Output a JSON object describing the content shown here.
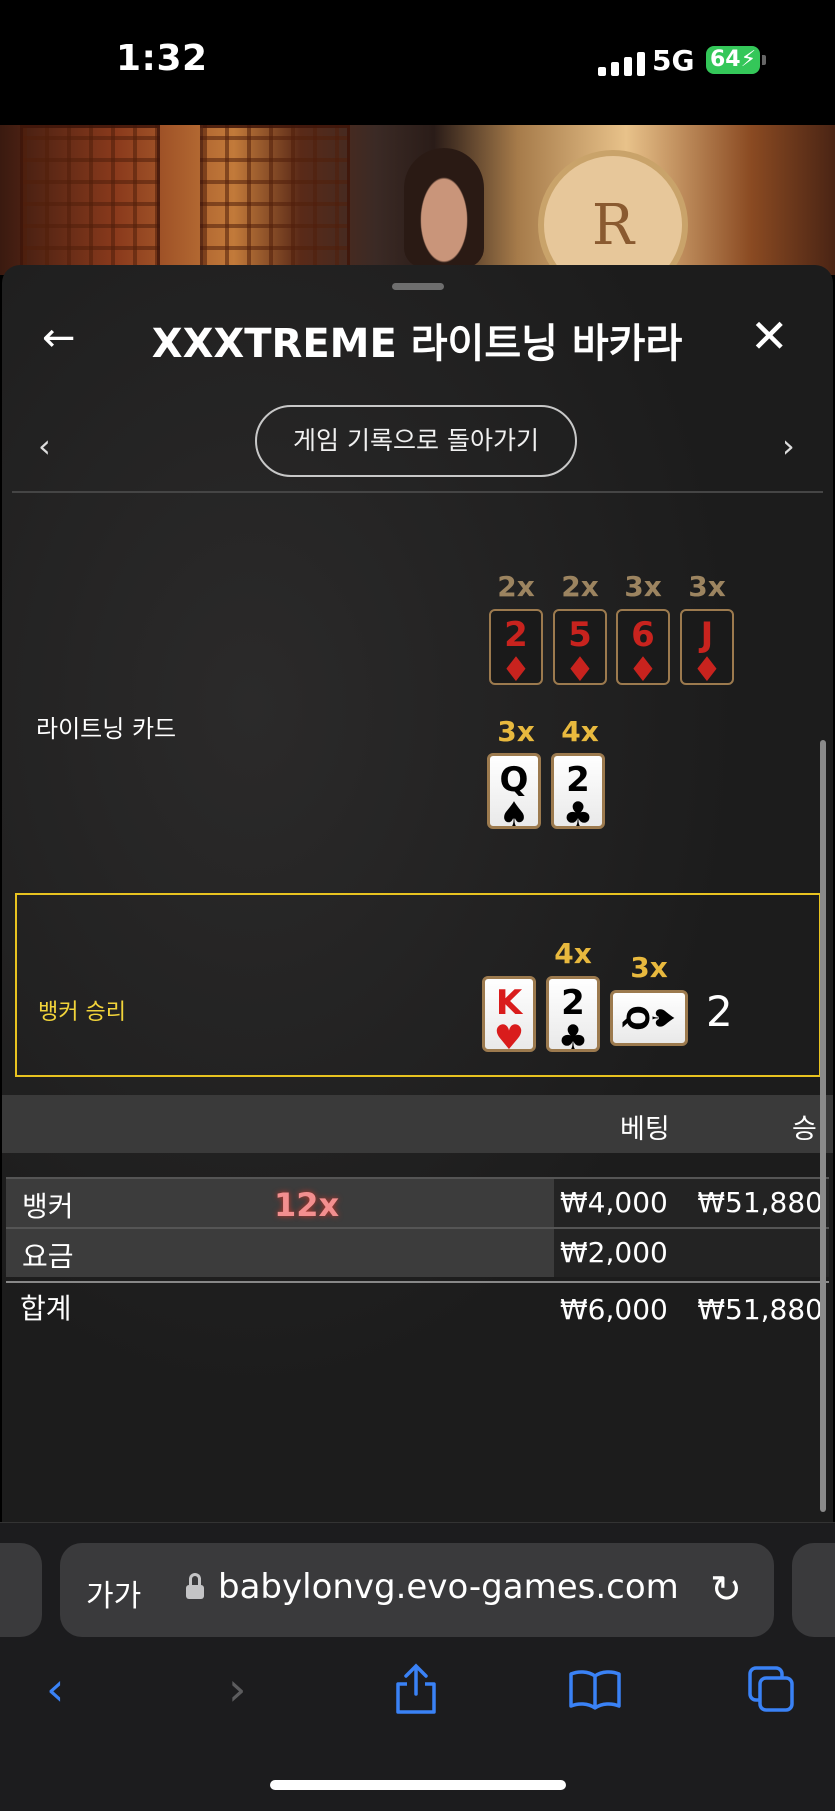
{
  "status": {
    "time": "1:32",
    "network": "5G",
    "battery": "64"
  },
  "header": {
    "title": "XXXTREME 라이트닝 바카라",
    "back_icon": "←",
    "close_icon": "✕"
  },
  "nav": {
    "prev_icon": "‹",
    "next_icon": "›",
    "history_button": "게임 기록으로 돌아가기"
  },
  "lightning_cards": {
    "label": "라이트닝 카드",
    "row1": [
      {
        "mult": "2x",
        "rank": "2",
        "suit": "♦"
      },
      {
        "mult": "2x",
        "rank": "5",
        "suit": "♦"
      },
      {
        "mult": "3x",
        "rank": "6",
        "suit": "♦"
      },
      {
        "mult": "3x",
        "rank": "J",
        "suit": "♦"
      }
    ],
    "row2": [
      {
        "mult": "3x",
        "rank": "Q",
        "suit": "♠"
      },
      {
        "mult": "4x",
        "rank": "2",
        "suit": "♣"
      }
    ]
  },
  "result": {
    "label": "뱅커 승리",
    "cards": [
      {
        "mult": "",
        "rank": "K",
        "suit": "♥"
      },
      {
        "mult": "4x",
        "rank": "2",
        "suit": "♣"
      },
      {
        "mult": "3x",
        "rank": "Q",
        "suit": "♠"
      }
    ],
    "total": "2"
  },
  "table": {
    "headers": {
      "bet": "베팅",
      "win": "승"
    },
    "rows": [
      {
        "label": "뱅커",
        "mult": "12x",
        "bet": "₩4,000",
        "win": "₩51,880"
      },
      {
        "label": "요금",
        "mult": "",
        "bet": "₩2,000",
        "win": ""
      }
    ],
    "total": {
      "label": "합계",
      "bet": "₩6,000",
      "win": "₩51,880"
    }
  },
  "browser": {
    "text_size": "가가",
    "url": "babylonvg.evo-games.com",
    "reload_icon": "↻",
    "toolbar": {
      "back_icon": "‹",
      "forward_icon": "›",
      "share_icon": "share",
      "bookmarks_icon": "book",
      "tabs_icon": "tabs"
    }
  },
  "colors": {
    "accent_gold": "#e8c320",
    "battery_green": "#34c759",
    "ios_blue": "#3a82f6"
  }
}
